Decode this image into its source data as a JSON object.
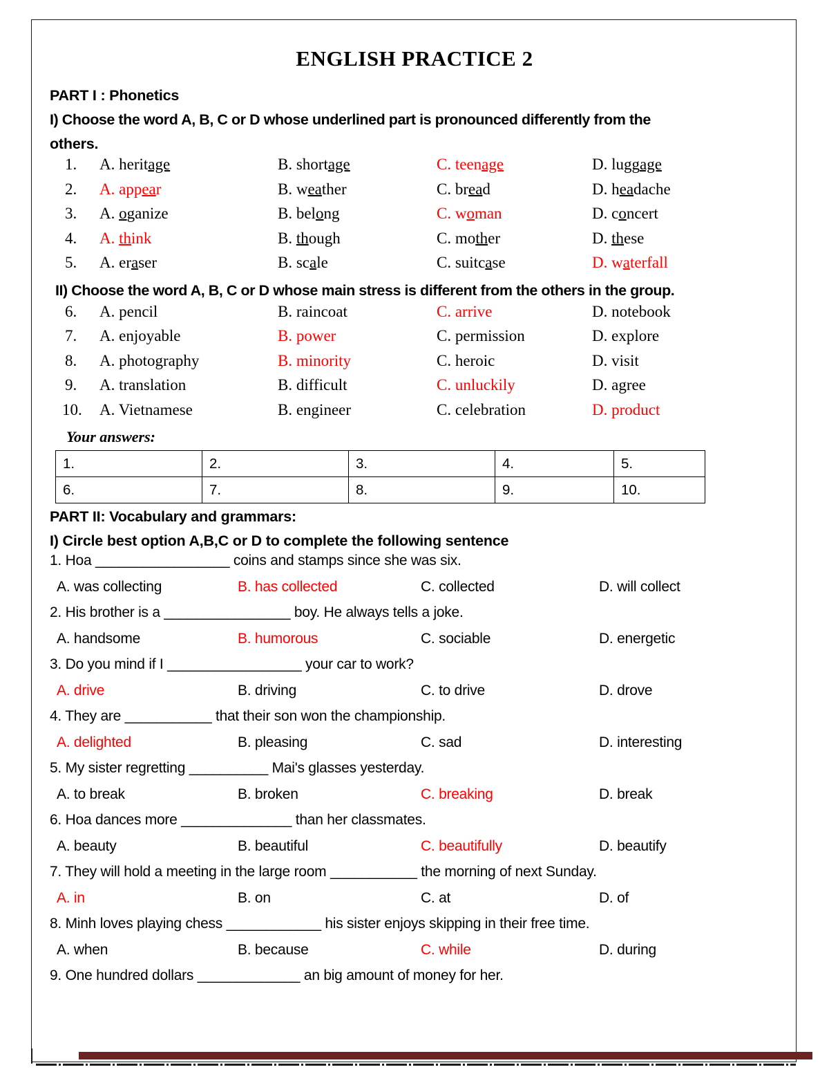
{
  "document": {
    "title": "ENGLISH PRACTICE 2",
    "accent_red": "#ff0000",
    "accent_maroon": "#6b2323"
  },
  "part1": {
    "heading": "PART I : Phonetics",
    "section_i_instruction": "I) Choose the word A, B, C or D whose underlined part is pronounced differently from the",
    "section_i_instruction_cont": "others.",
    "section_ii_instruction": "II) Choose the word A, B, C or D whose main stress is different from the others in the group.",
    "questions_i": [
      {
        "num": "1.",
        "options": [
          {
            "label": "A.",
            "pre": "herit",
            "mid": "age",
            "post": "",
            "red": false,
            "underline": true
          },
          {
            "label": "B.",
            "pre": "short",
            "mid": "age",
            "post": "",
            "red": false,
            "underline": true
          },
          {
            "label": "C.",
            "pre": "teen",
            "mid": "age",
            "post": "",
            "red": true,
            "underline": true
          },
          {
            "label": "D.",
            "pre": "lugg",
            "mid": "age",
            "post": "",
            "red": false,
            "underline": true
          }
        ]
      },
      {
        "num": "2.",
        "options": [
          {
            "label": "A.",
            "pre": "app",
            "mid": "ea",
            "post": "r",
            "red": true,
            "underline": true
          },
          {
            "label": "B.",
            "pre": "w",
            "mid": "ea",
            "post": "ther",
            "red": false,
            "underline": true
          },
          {
            "label": "C.",
            "pre": "br",
            "mid": "ea",
            "post": "d",
            "red": false,
            "underline": true
          },
          {
            "label": "D.",
            "pre": "h",
            "mid": "ea",
            "post": "dache",
            "red": false,
            "underline": true
          }
        ]
      },
      {
        "num": "3.",
        "options": [
          {
            "label": "A.",
            "pre": "",
            "mid": "o",
            "post": "ganize",
            "red": false,
            "underline": true
          },
          {
            "label": "B.",
            "pre": "bel",
            "mid": "o",
            "post": "ng",
            "red": false,
            "underline": true
          },
          {
            "label": "C.",
            "pre": " w",
            "mid": "o",
            "post": "man",
            "red": true,
            "underline": true
          },
          {
            "label": "D.",
            "pre": "c",
            "mid": "o",
            "post": "ncert",
            "red": false,
            "underline": true
          }
        ]
      },
      {
        "num": "4.",
        "options": [
          {
            "label": "A.",
            "pre": "",
            "mid": "th",
            "post": "ink",
            "red": true,
            "underline": true
          },
          {
            "label": "B.",
            "pre": "",
            "mid": "th",
            "post": "ough",
            "red": false,
            "underline": true
          },
          {
            "label": "C.",
            "pre": "mo",
            "mid": "th",
            "post": "er",
            "red": false,
            "underline": true
          },
          {
            "label": "D.",
            "pre": "",
            "mid": "th",
            "post": "ese",
            "red": false,
            "underline": true
          }
        ]
      },
      {
        "num": "5.",
        "options": [
          {
            "label": "A.",
            "pre": "er",
            "mid": "a",
            "post": "ser",
            "red": false,
            "underline": true
          },
          {
            "label": "B.",
            "pre": "sc",
            "mid": "a",
            "post": "le",
            "red": false,
            "underline": true
          },
          {
            "label": "C.",
            "pre": "suitc",
            "mid": "a",
            "post": "se",
            "red": false,
            "underline": true
          },
          {
            "label": "D.",
            "pre": "w",
            "mid": "a",
            "post": "terfall",
            "red": true,
            "underline": true
          }
        ]
      }
    ],
    "questions_ii": [
      {
        "num": "6.",
        "options": [
          {
            "label": "A.",
            "text": "pencil",
            "red": false
          },
          {
            "label": "B.",
            "text": "raincoat",
            "red": false
          },
          {
            "label": "C.",
            "text": "arrive",
            "red": true
          },
          {
            "label": "D.",
            "text": "notebook",
            "red": false
          }
        ]
      },
      {
        "num": "7.",
        "options": [
          {
            "label": "A.",
            "text": "enjoyable",
            "red": false
          },
          {
            "label": "B.",
            "text": "power",
            "red": true
          },
          {
            "label": "C.",
            "text": "permission",
            "red": false
          },
          {
            "label": "D.",
            "text": "explore",
            "red": false
          }
        ]
      },
      {
        "num": "8.",
        "options": [
          {
            "label": "A.",
            "text": "photography",
            "red": false
          },
          {
            "label": "B.",
            "text": "minority",
            "red": true
          },
          {
            "label": "C.",
            "text": "heroic",
            "red": false
          },
          {
            "label": "D.",
            "text": "visit",
            "red": false
          }
        ]
      },
      {
        "num": "9.",
        "options": [
          {
            "label": "A.",
            "text": "translation",
            "red": false
          },
          {
            "label": "B.",
            "text": "difficult",
            "red": false
          },
          {
            "label": "C.",
            "text": "unluckily",
            "red": true
          },
          {
            "label": "D.",
            "text": "agree",
            "red": false
          }
        ]
      },
      {
        "num": "10.",
        "options": [
          {
            "label": "A.",
            "text": "Vietnamese",
            "red": false
          },
          {
            "label": "B.",
            "text": "engineer",
            "red": false
          },
          {
            "label": "C.",
            "text": "celebration",
            "red": false
          },
          {
            "label": "D.",
            "text": "product",
            "red": true
          }
        ]
      }
    ],
    "your_answers_label": "Your answers:",
    "answer_table": [
      [
        "1.",
        "2.",
        "3.",
        "4.",
        "5."
      ],
      [
        "6.",
        "7.",
        "8.",
        "9.",
        "10."
      ]
    ]
  },
  "part2": {
    "heading": "PART II: Vocabulary and grammars:",
    "section_i_instruction": "I) Circle best option A,B,C or D to complete the following sentence",
    "questions": [
      {
        "stem": "1. Hoa _________________ coins and stamps since she was six.",
        "options": [
          {
            "text": "A. was collecting",
            "red": false
          },
          {
            "text": "B. has collected",
            "red": true
          },
          {
            "text": "C. collected",
            "red": false
          },
          {
            "text": "D. will collect",
            "red": false
          }
        ]
      },
      {
        "stem": "2. His brother is a ________________ boy. He always tells a joke.",
        "options": [
          {
            "text": "A. handsome",
            "red": false
          },
          {
            "text": "B. humorous",
            "red": true
          },
          {
            "text": "C. sociable",
            "red": false
          },
          {
            "text": "D. energetic",
            "red": false
          }
        ]
      },
      {
        "stem": "3. Do you mind if I _________________ your car to work?",
        "options": [
          {
            "text": "A. drive",
            "red": true
          },
          {
            "text": "B. driving",
            "red": false
          },
          {
            "text": "C. to drive",
            "red": false
          },
          {
            "text": "D. drove",
            "red": false
          }
        ]
      },
      {
        "stem": "4. They are ___________ that their son won the championship.",
        "options": [
          {
            "text": "A. delighted",
            "red": true
          },
          {
            "text": "B. pleasing",
            "red": false
          },
          {
            "text": "C. sad",
            "red": false
          },
          {
            "text": "D. interesting",
            "red": false
          }
        ]
      },
      {
        "stem": "5. My sister regretting __________ Mai's glasses yesterday.",
        "options": [
          {
            "text": "A. to break",
            "red": false
          },
          {
            "text": "B. broken",
            "red": false
          },
          {
            "text": "C. breaking",
            "red": true
          },
          {
            "text": "D. break",
            "red": false
          }
        ]
      },
      {
        "stem": "6. Hoa dances more ______________ than her classmates.",
        "options": [
          {
            "text": "A. beauty",
            "red": false
          },
          {
            "text": "B. beautiful",
            "red": false
          },
          {
            "text": "C. beautifully",
            "red": true
          },
          {
            "text": "D. beautify",
            "red": false
          }
        ]
      },
      {
        "stem": "7. They will hold a meeting in the large room ___________ the morning of next Sunday.",
        "options": [
          {
            "text": "A. in",
            "red": true
          },
          {
            "text": "B. on",
            "red": false
          },
          {
            "text": "C. at",
            "red": false
          },
          {
            "text": "D. of",
            "red": false
          }
        ]
      },
      {
        "stem": "8. Minh loves playing chess ____________ his sister enjoys skipping in their free time.",
        "options": [
          {
            "text": "A. when",
            "red": false
          },
          {
            "text": "B. because",
            "red": false
          },
          {
            "text": "C. while",
            "red": true
          },
          {
            "text": "D. during",
            "red": false
          }
        ]
      },
      {
        "stem": "9. One hundred dollars _____________ an big amount of money for her.",
        "options": []
      }
    ]
  }
}
